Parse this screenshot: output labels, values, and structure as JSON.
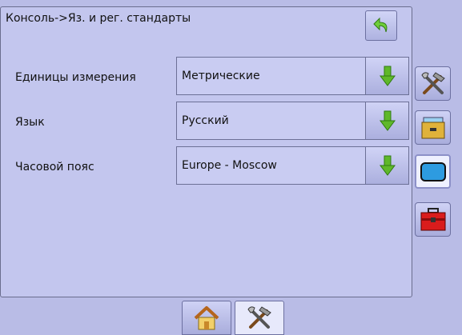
{
  "header": {
    "breadcrumb": "Консоль->Яз. и рег. стандарты"
  },
  "settings": [
    {
      "label": "Единицы измерения",
      "value": "Метрические"
    },
    {
      "label": "Язык",
      "value": "Русский"
    },
    {
      "label": "Часовой пояс",
      "value": "Europe - Moscow"
    }
  ],
  "side_tabs": [
    {
      "icon": "tools-icon",
      "active": false
    },
    {
      "icon": "file-cabinet-icon",
      "active": false
    },
    {
      "icon": "display-icon",
      "active": true
    },
    {
      "icon": "toolbox-icon",
      "active": false
    }
  ],
  "bottom_tabs": [
    {
      "icon": "home-icon",
      "active": false
    },
    {
      "icon": "tools-icon",
      "active": true
    }
  ],
  "colors": {
    "background": "#b9bce6",
    "arrow_green": "#5fb82a",
    "back_arrow_green": "#6fcf3a"
  }
}
